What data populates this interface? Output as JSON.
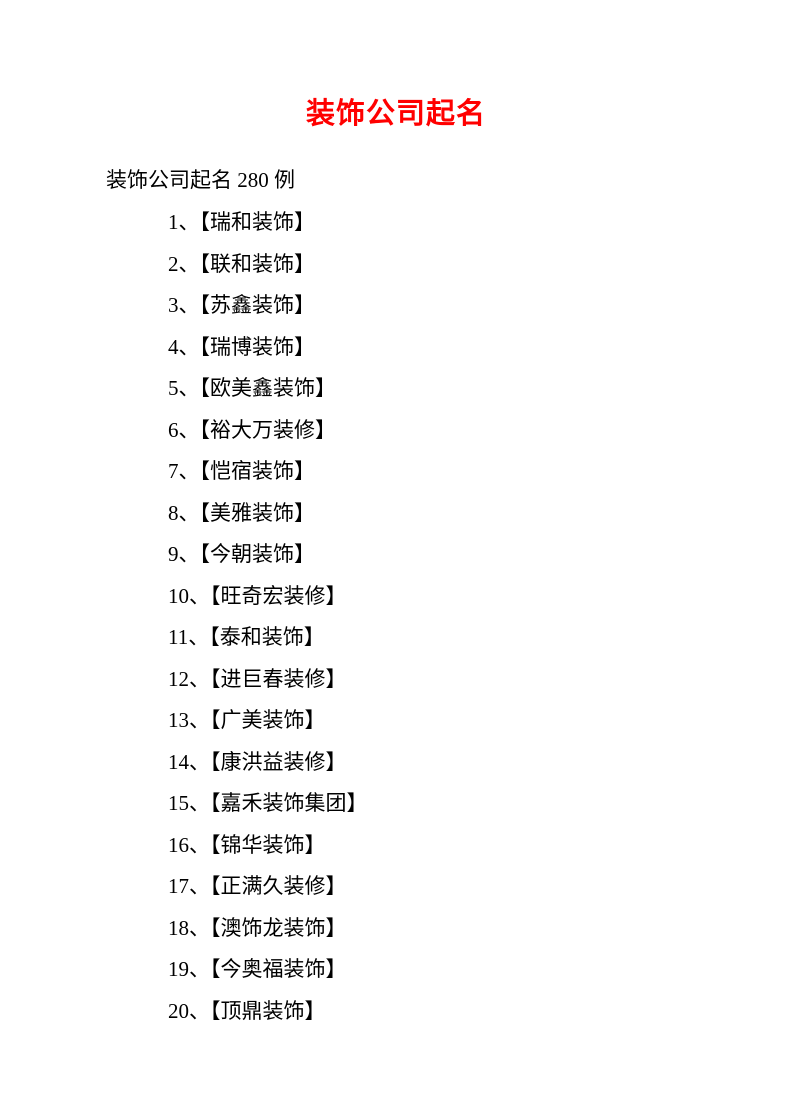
{
  "title": "装饰公司起名",
  "subtitle": "装饰公司起名 280 例",
  "items": [
    "1、【瑞和装饰】",
    "2、【联和装饰】",
    "3、【苏鑫装饰】",
    "4、【瑞博装饰】",
    "5、【欧美鑫装饰】",
    "6、【裕大万装修】",
    "7、【恺宿装饰】",
    "8、【美雅装饰】",
    "9、【今朝装饰】",
    "10、【旺奇宏装修】",
    "11、【泰和装饰】",
    "12、【进巨春装修】",
    "13、【广美装饰】",
    "14、【康洪益装修】",
    "15、【嘉禾装饰集团】",
    "16、【锦华装饰】",
    "17、【正满久装修】",
    "18、【澳饰龙装饰】",
    "19、【今奥福装饰】",
    "20、【顶鼎装饰】"
  ]
}
